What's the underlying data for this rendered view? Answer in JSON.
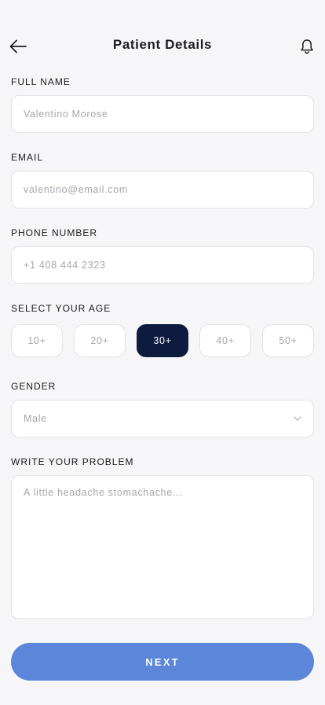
{
  "header": {
    "title": "Patient Details",
    "back_icon": "arrow-left-icon",
    "bell_icon": "bell-icon"
  },
  "form": {
    "full_name": {
      "label": "FULL NAME",
      "placeholder": "Valentino Morose"
    },
    "email": {
      "label": "EMAIL",
      "placeholder": "valentino@email.com"
    },
    "phone": {
      "label": "PHONE NUMBER",
      "placeholder": "+1 408 444 2323"
    },
    "age": {
      "label": "SELECT YOUR AGE",
      "options": [
        "10+",
        "20+",
        "30+",
        "40+",
        "50+"
      ],
      "selected": "30+"
    },
    "gender": {
      "label": "GENDER",
      "value": "Male",
      "icon": "chevron-down-icon"
    },
    "problem": {
      "label": "WRITE YOUR PROBLEM",
      "placeholder": "A little headache stomachache..."
    }
  },
  "actions": {
    "next_label": "NEXT"
  },
  "colors": {
    "background": "#f6f6f8",
    "accent": "#5b86d9",
    "selected_pill": "#0d1b3e",
    "border": "#e3e3e8",
    "placeholder": "#a6a6ad"
  }
}
